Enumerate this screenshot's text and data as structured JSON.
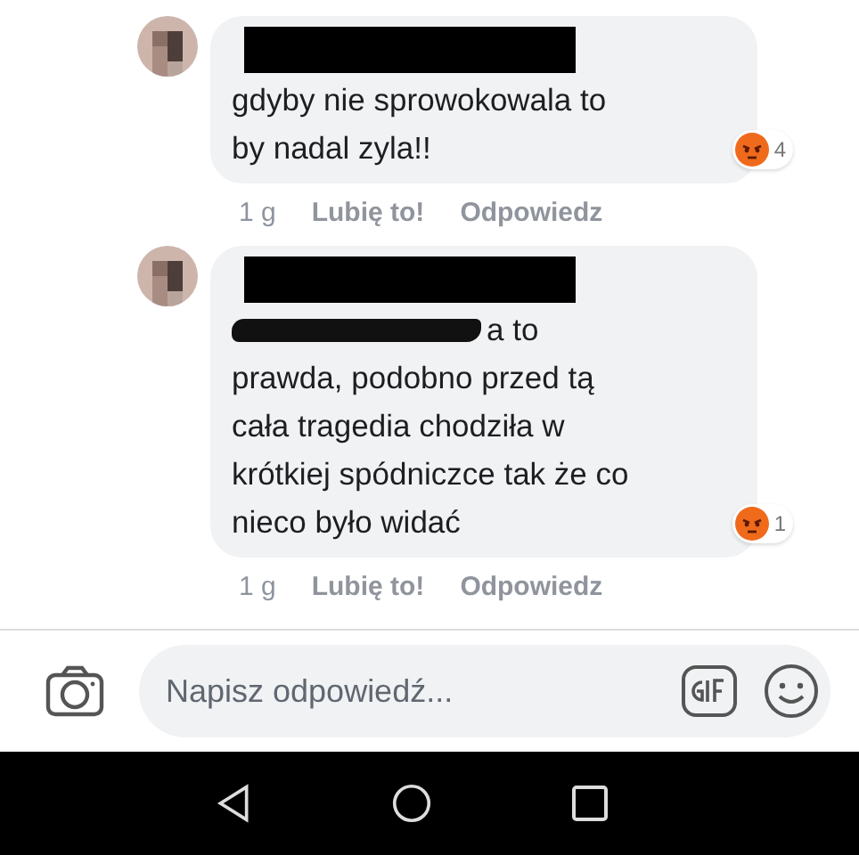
{
  "comments": [
    {
      "name_redacted": true,
      "text_scribbled": false,
      "lines": [
        "gdyby nie sprowokowala to",
        "by nadal zyla!!"
      ],
      "reaction": {
        "kind": "angry",
        "count": "4"
      },
      "time": "1 g",
      "like": "Lubię to!",
      "reply": "Odpowiedz"
    },
    {
      "name_redacted": true,
      "text_scribbled": true,
      "lines": [
        "a to",
        "prawda, podobno przed tą",
        "cała tragedia chodziła w",
        "krótkiej spódniczce tak że co",
        "nieco było widać"
      ],
      "reaction": {
        "kind": "angry",
        "count": "1"
      },
      "time": "1 g",
      "like": "Lubię to!",
      "reply": "Odpowiedz"
    }
  ],
  "composer": {
    "placeholder": "Napisz odpowiedź..."
  }
}
